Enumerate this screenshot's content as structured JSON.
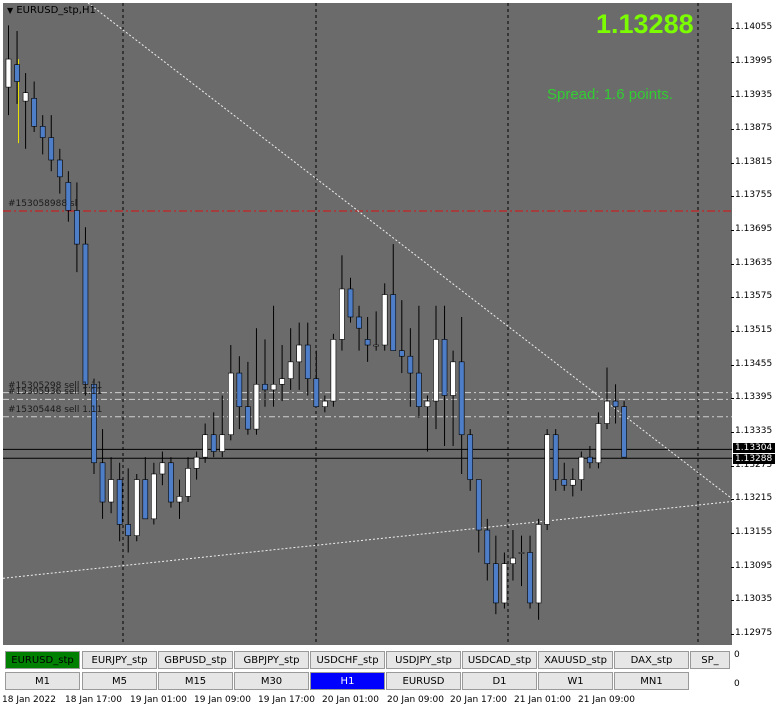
{
  "window": {
    "title": "EURUSD_stp,H1"
  },
  "price_display": "1.13288",
  "spread_text": "Spread: 1.6 points.",
  "colors": {
    "background": "#6b6b6b",
    "bull": "#ffffff",
    "bear": "#4f7ec8",
    "price_big": "#7cfc00",
    "spread": "#32cd32",
    "stop_line": "#dd1111",
    "active_symbol": "#008000",
    "active_timeframe": "#0000ff"
  },
  "price_axis": {
    "ticks": [
      "1.14055",
      "1.13995",
      "1.13935",
      "1.13875",
      "1.13815",
      "1.13755",
      "1.13695",
      "1.13635",
      "1.13575",
      "1.13515",
      "1.13455",
      "1.13395",
      "1.13335",
      "1.13275",
      "1.13215",
      "1.13155",
      "1.13095",
      "1.13035",
      "1.12975"
    ],
    "current_boxes": [
      "1.13304",
      "1.13288"
    ]
  },
  "orders": [
    {
      "label": "#153058988 sl",
      "price": 1.13729,
      "kind": "stop"
    },
    {
      "label": "#15305298 sell 1.11",
      "price": 1.13405,
      "kind": "order"
    },
    {
      "label": "#15305936 sell 1.11",
      "price": 1.13393,
      "kind": "order"
    },
    {
      "label": "#15305448 sell 1.11",
      "price": 1.13362,
      "kind": "order"
    }
  ],
  "time_axis": [
    "18 Jan 2022",
    "18 Jan 17:00",
    "19 Jan 01:00",
    "19 Jan 09:00",
    "19 Jan 17:00",
    "20 Jan 01:00",
    "20 Jan 09:00",
    "20 Jan 17:00",
    "21 Jan 01:00",
    "21 Jan 09:00"
  ],
  "symbol_buttons": [
    "EURUSD_stp",
    "EURJPY_stp",
    "GBPUSD_stp",
    "GBPJPY_stp",
    "USDCHF_stp",
    "USDJPY_stp",
    "USDCAD_stp",
    "XAUUSD_stp",
    "DAX_stp",
    "SP_"
  ],
  "active_symbol": "EURUSD_stp",
  "timeframe_buttons": [
    "M1",
    "M5",
    "M15",
    "M30",
    "H1",
    "EURUSD",
    "D1",
    "W1",
    "MN1"
  ],
  "active_timeframe": "H1",
  "subwindow_axis": [
    "0",
    "0"
  ],
  "chart_data": {
    "type": "candlestick",
    "symbol": "EURUSD_stp",
    "timeframe": "H1",
    "ylim": [
      1.12955,
      1.141
    ],
    "candles": [
      {
        "o": 1.1395,
        "h": 1.1406,
        "l": 1.139,
        "c": 1.14
      },
      {
        "o": 1.1399,
        "h": 1.1405,
        "l": 1.1392,
        "c": 1.1396
      },
      {
        "o": 1.13925,
        "h": 1.13975,
        "l": 1.1384,
        "c": 1.1394
      },
      {
        "o": 1.1393,
        "h": 1.1396,
        "l": 1.1387,
        "c": 1.1388
      },
      {
        "o": 1.1388,
        "h": 1.139,
        "l": 1.1383,
        "c": 1.1386
      },
      {
        "o": 1.1386,
        "h": 1.139,
        "l": 1.138,
        "c": 1.1382
      },
      {
        "o": 1.1382,
        "h": 1.1384,
        "l": 1.1376,
        "c": 1.1379
      },
      {
        "o": 1.1378,
        "h": 1.138,
        "l": 1.1371,
        "c": 1.1373
      },
      {
        "o": 1.1373,
        "h": 1.1378,
        "l": 1.1362,
        "c": 1.1367
      },
      {
        "o": 1.1367,
        "h": 1.137,
        "l": 1.134,
        "c": 1.1342
      },
      {
        "o": 1.1342,
        "h": 1.1343,
        "l": 1.1326,
        "c": 1.1328
      },
      {
        "o": 1.1328,
        "h": 1.1334,
        "l": 1.1318,
        "c": 1.1321
      },
      {
        "o": 1.1321,
        "h": 1.1329,
        "l": 1.1319,
        "c": 1.1325
      },
      {
        "o": 1.1325,
        "h": 1.1328,
        "l": 1.1314,
        "c": 1.1317
      },
      {
        "o": 1.1317,
        "h": 1.1327,
        "l": 1.1312,
        "c": 1.1315
      },
      {
        "o": 1.1315,
        "h": 1.1326,
        "l": 1.1314,
        "c": 1.1325
      },
      {
        "o": 1.1325,
        "h": 1.1329,
        "l": 1.1318,
        "c": 1.1318
      },
      {
        "o": 1.1318,
        "h": 1.1328,
        "l": 1.1317,
        "c": 1.1326
      },
      {
        "o": 1.1326,
        "h": 1.133,
        "l": 1.1324,
        "c": 1.1328
      },
      {
        "o": 1.1328,
        "h": 1.1329,
        "l": 1.132,
        "c": 1.1321
      },
      {
        "o": 1.1321,
        "h": 1.1325,
        "l": 1.1318,
        "c": 1.1322
      },
      {
        "o": 1.1322,
        "h": 1.1329,
        "l": 1.1321,
        "c": 1.1327
      },
      {
        "o": 1.1327,
        "h": 1.133,
        "l": 1.1325,
        "c": 1.1329
      },
      {
        "o": 1.1329,
        "h": 1.1335,
        "l": 1.1328,
        "c": 1.1333
      },
      {
        "o": 1.1333,
        "h": 1.1337,
        "l": 1.1329,
        "c": 1.133
      },
      {
        "o": 1.133,
        "h": 1.134,
        "l": 1.1329,
        "c": 1.1333
      },
      {
        "o": 1.1333,
        "h": 1.1349,
        "l": 1.1332,
        "c": 1.1344
      },
      {
        "o": 1.1344,
        "h": 1.1347,
        "l": 1.1334,
        "c": 1.1338
      },
      {
        "o": 1.1338,
        "h": 1.1346,
        "l": 1.1333,
        "c": 1.1334
      },
      {
        "o": 1.1334,
        "h": 1.1352,
        "l": 1.1333,
        "c": 1.1342
      },
      {
        "o": 1.1342,
        "h": 1.135,
        "l": 1.1338,
        "c": 1.1341
      },
      {
        "o": 1.1341,
        "h": 1.1356,
        "l": 1.1338,
        "c": 1.1342
      },
      {
        "o": 1.1342,
        "h": 1.1349,
        "l": 1.1339,
        "c": 1.1343
      },
      {
        "o": 1.1343,
        "h": 1.1352,
        "l": 1.1341,
        "c": 1.1346
      },
      {
        "o": 1.1346,
        "h": 1.1353,
        "l": 1.1341,
        "c": 1.1349
      },
      {
        "o": 1.1349,
        "h": 1.1353,
        "l": 1.134,
        "c": 1.1343
      },
      {
        "o": 1.1343,
        "h": 1.1348,
        "l": 1.1338,
        "c": 1.1338
      },
      {
        "o": 1.1338,
        "h": 1.134,
        "l": 1.1337,
        "c": 1.1339
      },
      {
        "o": 1.1339,
        "h": 1.1351,
        "l": 1.1338,
        "c": 1.135
      },
      {
        "o": 1.135,
        "h": 1.1365,
        "l": 1.1348,
        "c": 1.1359
      },
      {
        "o": 1.1359,
        "h": 1.1361,
        "l": 1.1353,
        "c": 1.1354
      },
      {
        "o": 1.1354,
        "h": 1.1356,
        "l": 1.1348,
        "c": 1.1352
      },
      {
        "o": 1.135,
        "h": 1.1354,
        "l": 1.1346,
        "c": 1.1349
      },
      {
        "o": 1.1349,
        "h": 1.1355,
        "l": 1.1348,
        "c": 1.1349
      },
      {
        "o": 1.1349,
        "h": 1.136,
        "l": 1.1348,
        "c": 1.1358
      },
      {
        "o": 1.1358,
        "h": 1.1367,
        "l": 1.1348,
        "c": 1.1348
      },
      {
        "o": 1.1348,
        "h": 1.1357,
        "l": 1.1344,
        "c": 1.1347
      },
      {
        "o": 1.1347,
        "h": 1.1352,
        "l": 1.1338,
        "c": 1.1344
      },
      {
        "o": 1.1344,
        "h": 1.1356,
        "l": 1.1336,
        "c": 1.1338
      },
      {
        "o": 1.1338,
        "h": 1.134,
        "l": 1.133,
        "c": 1.1339
      },
      {
        "o": 1.1339,
        "h": 1.1356,
        "l": 1.1334,
        "c": 1.135
      },
      {
        "o": 1.135,
        "h": 1.1356,
        "l": 1.1331,
        "c": 1.134
      },
      {
        "o": 1.134,
        "h": 1.1348,
        "l": 1.1331,
        "c": 1.1346
      },
      {
        "o": 1.1346,
        "h": 1.1354,
        "l": 1.1326,
        "c": 1.1333
      },
      {
        "o": 1.1333,
        "h": 1.1334,
        "l": 1.1323,
        "c": 1.1325
      },
      {
        "o": 1.1325,
        "h": 1.1325,
        "l": 1.1312,
        "c": 1.1316
      },
      {
        "o": 1.1316,
        "h": 1.1318,
        "l": 1.1307,
        "c": 1.131
      },
      {
        "o": 1.131,
        "h": 1.1315,
        "l": 1.1301,
        "c": 1.1303
      },
      {
        "o": 1.1303,
        "h": 1.1312,
        "l": 1.1302,
        "c": 1.131
      },
      {
        "o": 1.131,
        "h": 1.1316,
        "l": 1.1307,
        "c": 1.1311
      },
      {
        "o": 1.1312,
        "h": 1.1315,
        "l": 1.1306,
        "c": 1.1312
      },
      {
        "o": 1.1312,
        "h": 1.1315,
        "l": 1.1302,
        "c": 1.1303
      },
      {
        "o": 1.1303,
        "h": 1.1318,
        "l": 1.13,
        "c": 1.1317
      },
      {
        "o": 1.1317,
        "h": 1.1334,
        "l": 1.1316,
        "c": 1.1333
      },
      {
        "o": 1.1333,
        "h": 1.1334,
        "l": 1.1323,
        "c": 1.1325
      },
      {
        "o": 1.1325,
        "h": 1.1328,
        "l": 1.1323,
        "c": 1.1324
      },
      {
        "o": 1.1324,
        "h": 1.1327,
        "l": 1.1322,
        "c": 1.1325
      },
      {
        "o": 1.1325,
        "h": 1.133,
        "l": 1.1323,
        "c": 1.1329
      },
      {
        "o": 1.1329,
        "h": 1.1331,
        "l": 1.1327,
        "c": 1.1328
      },
      {
        "o": 1.1328,
        "h": 1.1337,
        "l": 1.1327,
        "c": 1.1335
      },
      {
        "o": 1.1335,
        "h": 1.1345,
        "l": 1.1334,
        "c": 1.1339
      },
      {
        "o": 1.1339,
        "h": 1.1342,
        "l": 1.1335,
        "c": 1.1338
      },
      {
        "o": 1.1338,
        "h": 1.1339,
        "l": 1.1329,
        "c": 1.1329
      }
    ],
    "trendlines": [
      {
        "p1": [
          1.14098,
          "18 Jan 2022 start"
        ],
        "p2": [
          1.13216,
          "end"
        ],
        "style": "dotted"
      },
      {
        "p1": [
          1.13074,
          "start"
        ],
        "p2": [
          1.13211,
          "end"
        ],
        "style": "dotted"
      }
    ],
    "horizontal_lines": [
      1.13304,
      1.13288
    ]
  }
}
